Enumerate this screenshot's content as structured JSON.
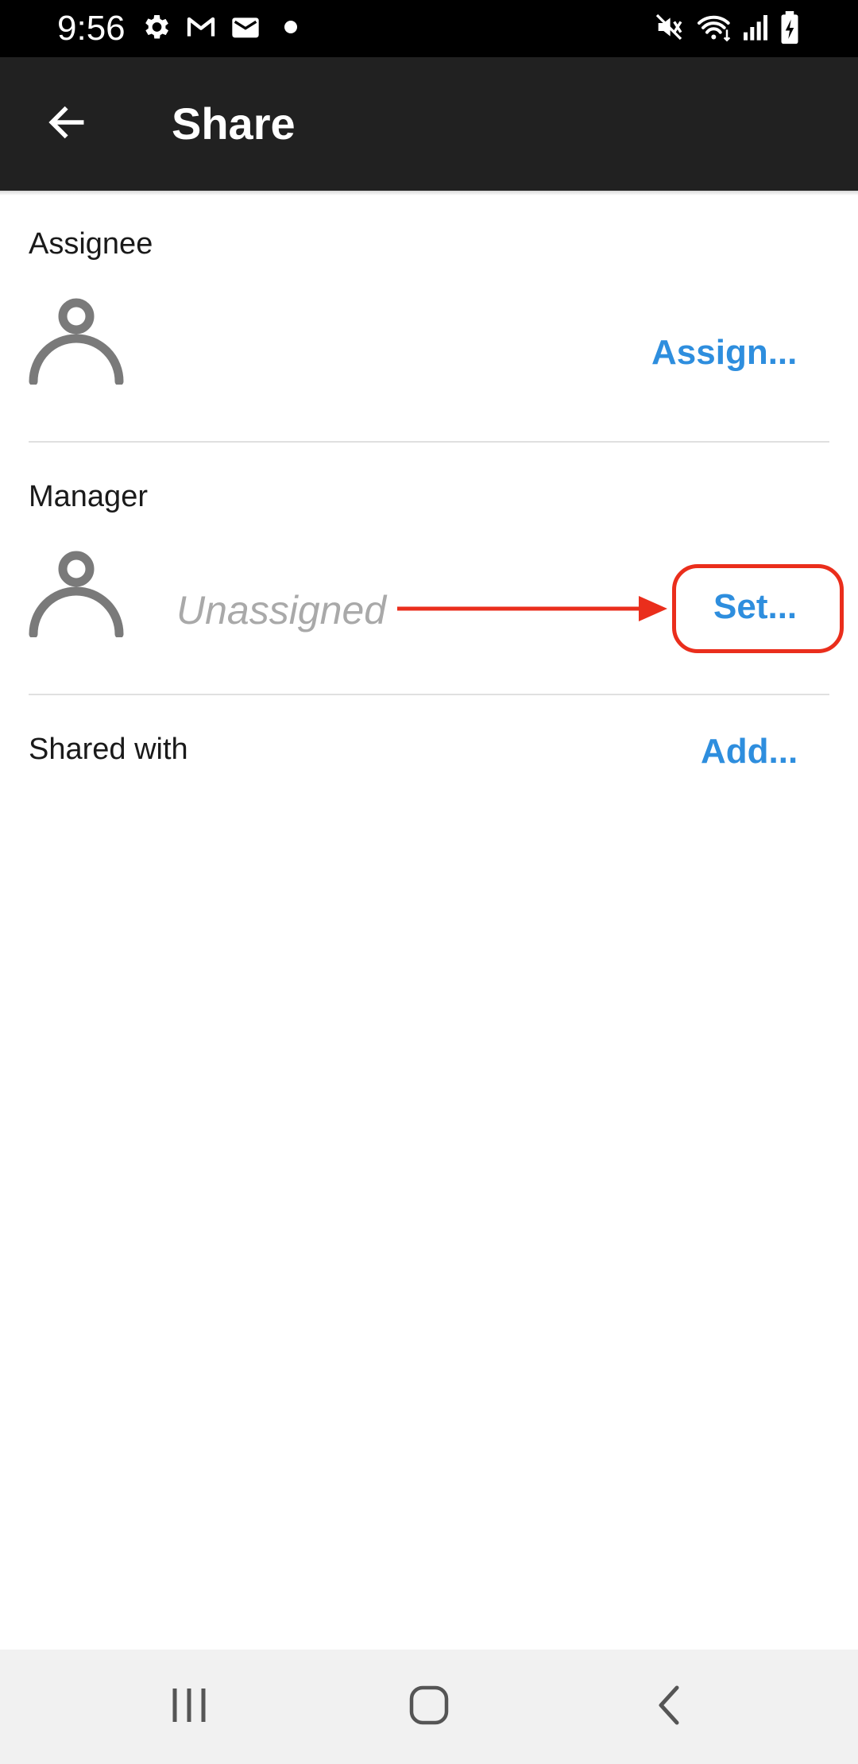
{
  "status_bar": {
    "time": "9:56",
    "left_icons": [
      "settings-icon",
      "gmail-icon",
      "mail-icon",
      "dot-icon"
    ],
    "right_icons": [
      "mute-icon",
      "wifi-icon",
      "signal-icon",
      "battery-charging-icon"
    ]
  },
  "app_bar": {
    "title": "Share",
    "back_icon": "arrow-back-icon"
  },
  "assignee": {
    "label": "Assignee",
    "action": "Assign..."
  },
  "manager": {
    "label": "Manager",
    "value": "Unassigned",
    "action": "Set..."
  },
  "shared_with": {
    "label": "Shared with",
    "action": "Add..."
  },
  "annotation": {
    "color": "#ea2e1c"
  },
  "colors": {
    "accent": "#2e8ede",
    "app_bar": "#212121",
    "avatar_gray": "#7a7a7a"
  },
  "nav_bar": {
    "buttons": [
      "recent-apps-icon",
      "home-icon",
      "back-nav-icon"
    ]
  }
}
